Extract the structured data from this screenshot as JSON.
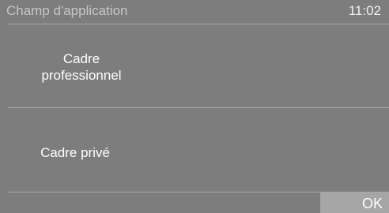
{
  "header": {
    "title": "Champ d'application",
    "time": "11:02"
  },
  "options": [
    {
      "line1": "Cadre",
      "line2": "professionnel"
    },
    {
      "label": "Cadre privé"
    }
  ],
  "footer": {
    "ok_label": "OK"
  },
  "colors": {
    "background": "#7d7d7d",
    "divider": "#a9a9a9",
    "ok_button": "#a6a6a6",
    "title_text": "#c6c6c6",
    "text": "#ffffff"
  }
}
